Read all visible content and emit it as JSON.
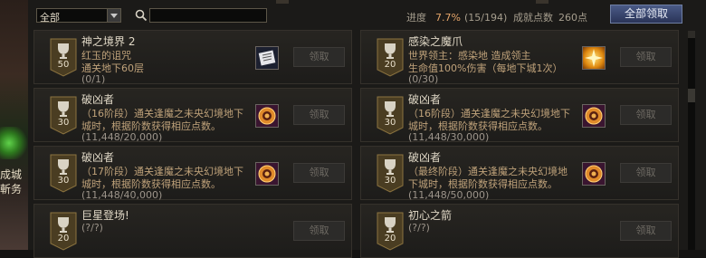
{
  "left_strip": {
    "line1": "成城",
    "line2": "斬务"
  },
  "toolbar": {
    "filter_value": "全部",
    "progress_label": "进度",
    "progress_percent": "7.7%",
    "progress_fraction": "(15/194)",
    "points_label": "成就点数",
    "points_value": "260点",
    "claim_all_label": "全部领取"
  },
  "cards": [
    {
      "badge": "50",
      "title": "神之境界 2",
      "line1": "红玉的诅咒",
      "line2": "通关地下60层",
      "line3": "(0/1)",
      "icon": "scroll-icon",
      "claim": "领取"
    },
    {
      "badge": "20",
      "title": "感染之魔爪",
      "line1": "世界领主：感染地     造成领主",
      "line2": "生命值100%伤害（每地下城1次）",
      "line3": "(0/30)",
      "icon": "sparkle-icon",
      "claim": "领取"
    },
    {
      "badge": "30",
      "title": "破凶者",
      "line1": "（16阶段）通关逢魔之未央幻境地下",
      "line2": "城时，根据阶数获得相应点数。",
      "line3": "(11,448/20,000)",
      "icon": "emblem-icon",
      "claim": "领取"
    },
    {
      "badge": "30",
      "title": "破凶者",
      "line1": "（16阶段）通关逢魔之未央幻境地下",
      "line2": "城时，根据阶数获得相应点数。",
      "line3": "(11,448/30,000)",
      "icon": "emblem-icon",
      "claim": "领取"
    },
    {
      "badge": "30",
      "title": "破凶者",
      "line1": "（17阶段）通关逢魔之未央幻境地下",
      "line2": "城时，根据阶数获得相应点数。",
      "line3": "(11,448/40,000)",
      "icon": "emblem-icon",
      "claim": "领取"
    },
    {
      "badge": "30",
      "title": "破凶者",
      "line1": "（最终阶段）通关逢魔之未央幻境地",
      "line2": "下城时，根据阶数获得相应点数。",
      "line3": "(11,448/50,000)",
      "icon": "emblem-icon",
      "claim": "领取"
    },
    {
      "badge": "20",
      "title": "巨星登场!",
      "line1": "(?/?)",
      "line2": "",
      "line3": "",
      "icon": "",
      "claim": "领取"
    },
    {
      "badge": "20",
      "title": "初心之箭",
      "line1": "(?/?)",
      "line2": "",
      "line3": "",
      "icon": "",
      "claim": "领取"
    }
  ]
}
